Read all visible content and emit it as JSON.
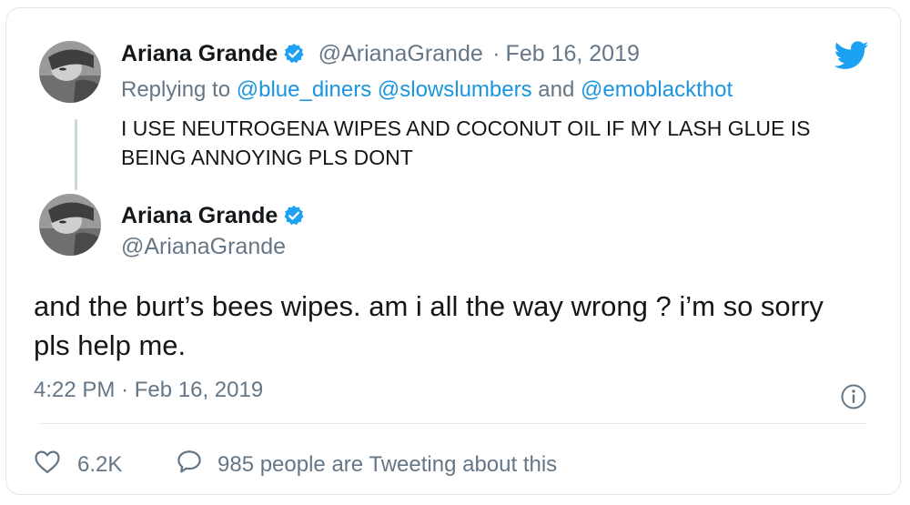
{
  "colors": {
    "accent": "#1da1f2",
    "text": "#14171a",
    "muted": "#657786",
    "border": "#e1e8ed"
  },
  "reply_tweet": {
    "author_name": "Ariana Grande",
    "handle": "@ArianaGrande",
    "separator": "·",
    "date": "Feb 16, 2019",
    "replying_prefix": "Replying to",
    "mentions": [
      "@blue_diners",
      "@slowslumbers",
      "@emoblackthot"
    ],
    "mention_and": "and",
    "text": "I USE NEUTROGENA WIPES AND COCONUT OIL IF MY LASH GLUE IS BEING ANNOYING PLS DONT"
  },
  "main_tweet": {
    "author_name": "Ariana Grande",
    "handle": "@ArianaGrande",
    "text": "and the burt’s bees wipes. am i all the way wrong ? i’m so sorry pls help me.",
    "time": "4:22 PM",
    "separator": "·",
    "date": "Feb 16, 2019"
  },
  "actions": {
    "likes": "6.2K",
    "conversation": "985 people are Tweeting about this"
  },
  "icons": {
    "logo": "twitter-bird-icon",
    "verified": "verified-badge-icon",
    "info": "info-icon",
    "like": "heart-icon",
    "reply": "speech-bubble-icon"
  }
}
